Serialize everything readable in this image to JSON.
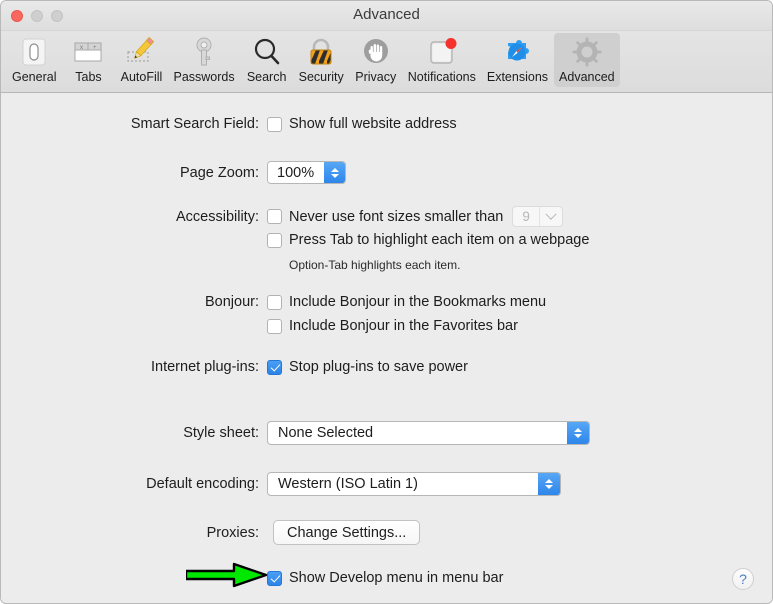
{
  "window": {
    "title": "Advanced",
    "traffic_lights": [
      "close-button",
      "minimize-button",
      "zoom-button"
    ]
  },
  "toolbar": {
    "items": [
      {
        "label": "General",
        "icon": "general-switch-icon",
        "selected": false
      },
      {
        "label": "Tabs",
        "icon": "tabs-window-icon",
        "selected": false
      },
      {
        "label": "AutoFill",
        "icon": "autofill-pencil-icon",
        "selected": false
      },
      {
        "label": "Passwords",
        "icon": "passwords-key-icon",
        "selected": false
      },
      {
        "label": "Search",
        "icon": "search-magnifier-icon",
        "selected": false
      },
      {
        "label": "Security",
        "icon": "security-lock-icon",
        "selected": false
      },
      {
        "label": "Privacy",
        "icon": "privacy-hand-icon",
        "selected": false
      },
      {
        "label": "Notifications",
        "icon": "notifications-badge-icon",
        "selected": false
      },
      {
        "label": "Extensions",
        "icon": "extensions-puzzle-icon",
        "selected": false
      },
      {
        "label": "Advanced",
        "icon": "advanced-gear-icon",
        "selected": true
      }
    ]
  },
  "settings": {
    "smart_search_field": {
      "label": "Smart Search Field:",
      "checkbox_label": "Show full website address",
      "checked": false
    },
    "page_zoom": {
      "label": "Page Zoom:",
      "value": "100%"
    },
    "accessibility": {
      "label": "Accessibility:",
      "never_use_font_sizes_label": "Never use font sizes smaller than",
      "never_use_font_sizes_checked": false,
      "font_size_value": "9",
      "font_size_disabled": true,
      "press_tab_label": "Press Tab to highlight each item on a webpage",
      "press_tab_checked": false,
      "note": "Option-Tab highlights each item."
    },
    "bonjour": {
      "label": "Bonjour:",
      "bookmarks_label": "Include Bonjour in the Bookmarks menu",
      "bookmarks_checked": false,
      "favorites_label": "Include Bonjour in the Favorites bar",
      "favorites_checked": false
    },
    "internet_plugins": {
      "label": "Internet plug-ins:",
      "checkbox_label": "Stop plug-ins to save power",
      "checked": true
    },
    "style_sheet": {
      "label": "Style sheet:",
      "value": "None Selected"
    },
    "default_encoding": {
      "label": "Default encoding:",
      "value": "Western (ISO Latin 1)"
    },
    "proxies": {
      "label": "Proxies:",
      "button_label": "Change Settings..."
    },
    "develop_menu": {
      "checkbox_label": "Show Develop menu in menu bar",
      "checked": true
    }
  },
  "help_button": {
    "glyph": "?"
  },
  "annotation": {
    "type": "green-arrow",
    "points_to": "develop-menu-checkbox"
  },
  "colors": {
    "accent_blue": "#2e86ea",
    "window_bg": "#ececec",
    "toolbar_selected": "#cfcfcf",
    "annotation_green": "#00e000",
    "close_red": "#f9685f"
  }
}
